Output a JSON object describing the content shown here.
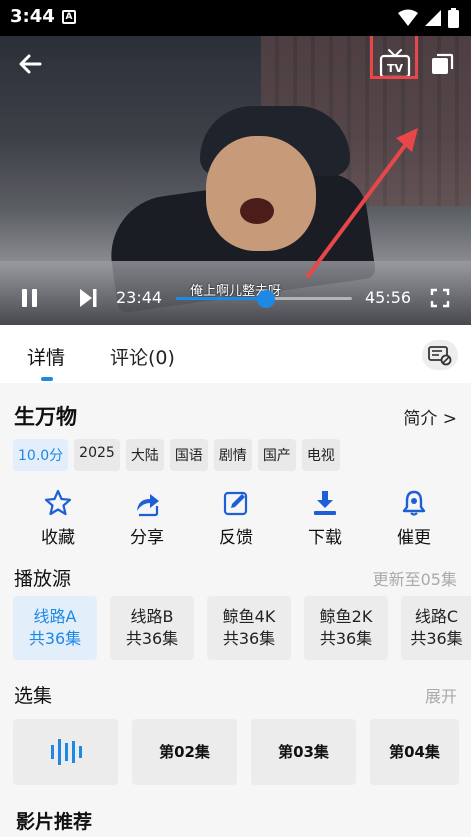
{
  "status_bar": {
    "time": "3:44",
    "badge": "A"
  },
  "player": {
    "subtitle": "俺上啊儿整去呀",
    "current_time": "23:44",
    "total_time": "45:56",
    "progress": 0.51,
    "annotation_color": "#e8474a"
  },
  "tabs": [
    {
      "label": "详情"
    },
    {
      "label": "评论(0)"
    }
  ],
  "detail": {
    "title": "生万物",
    "intro_link": "简介 >",
    "tags": [
      "10.0分",
      "2025",
      "大陆",
      "国语",
      "剧情",
      "国产",
      "电视"
    ]
  },
  "actions": [
    {
      "label": "收藏",
      "icon": "star-icon"
    },
    {
      "label": "分享",
      "icon": "share-icon"
    },
    {
      "label": "反馈",
      "icon": "edit-icon"
    },
    {
      "label": "下载",
      "icon": "download-icon"
    },
    {
      "label": "催更",
      "icon": "bell-icon"
    }
  ],
  "sources": {
    "title": "播放源",
    "update_note": "更新至05集",
    "items": [
      {
        "name": "线路A",
        "count": "共36集"
      },
      {
        "name": "线路B",
        "count": "共36集"
      },
      {
        "name": "鲸鱼4K",
        "count": "共36集"
      },
      {
        "name": "鲸鱼2K",
        "count": "共36集"
      },
      {
        "name": "线路C",
        "count": "共36集"
      }
    ]
  },
  "episodes": {
    "title": "选集",
    "expand": "展开",
    "items": [
      "",
      "第02集",
      "第03集",
      "第04集"
    ]
  },
  "recommend_title": "影片推荐",
  "colors": {
    "accent": "#1e88e5",
    "status_bar": "#000000"
  }
}
